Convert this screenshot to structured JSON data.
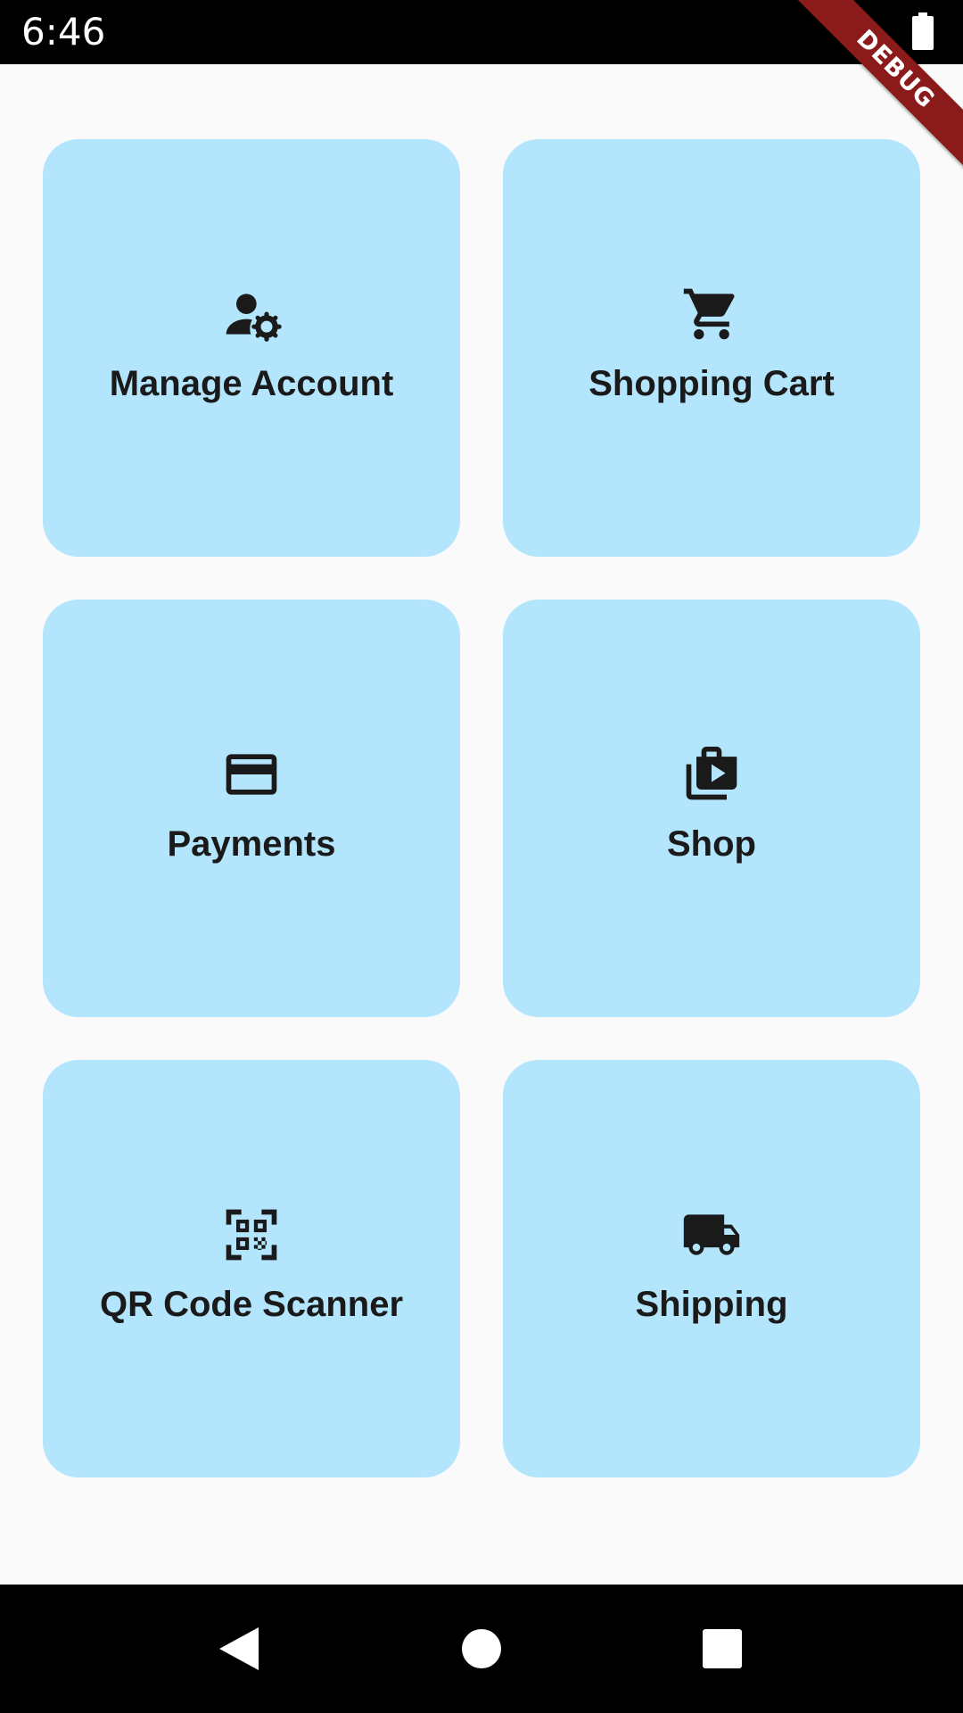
{
  "status_bar": {
    "time": "6:46",
    "battery_icon": "battery-full-icon"
  },
  "debug_banner": {
    "label": "DEBUG",
    "color": "#8b1a1a"
  },
  "theme": {
    "card_color": "#b3e5fc",
    "background": "#fafafa",
    "text_color": "#1a1a1a"
  },
  "menu": {
    "items": [
      {
        "label": "Manage Account",
        "icon": "manage-accounts-icon"
      },
      {
        "label": "Shopping Cart",
        "icon": "shopping-cart-icon"
      },
      {
        "label": "Payments",
        "icon": "credit-card-icon"
      },
      {
        "label": "Shop",
        "icon": "shop-icon"
      },
      {
        "label": "QR Code Scanner",
        "icon": "qr-code-scanner-icon"
      },
      {
        "label": "Shipping",
        "icon": "shipping-truck-icon"
      }
    ]
  },
  "nav_bar": {
    "back_icon": "back-triangle-icon",
    "home_icon": "home-circle-icon",
    "recents_icon": "recents-square-icon"
  }
}
